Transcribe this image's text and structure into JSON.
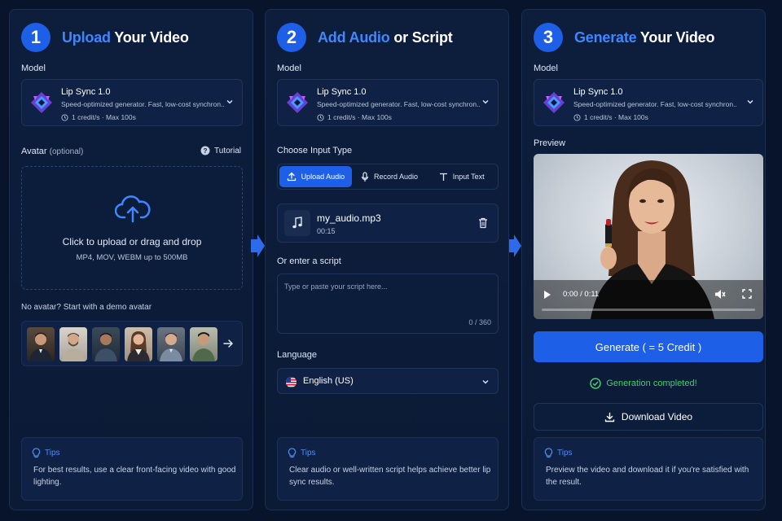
{
  "step1": {
    "number": "1",
    "title_accent": "Upload",
    "title_rest": " Your Video",
    "model_label": "Model",
    "model": {
      "name": "Lip Sync 1.0",
      "desc": "Speed-optimized generator. Fast, low-cost synchron...",
      "meta": "1 credit/s · Max 100s"
    },
    "avatar_label": "Avatar",
    "avatar_optional": "(optional)",
    "tutorial": "Tutorial",
    "upload_text": "Click to upload or drag and drop",
    "upload_sub": "MP4, MOV, WEBM up to 500MB",
    "demo_label": "No avatar? Start with a demo avatar",
    "tips_title": "Tips",
    "tips_body": "For best results, use a clear front-facing video with good lighting."
  },
  "step2": {
    "number": "2",
    "title_accent": "Add Audio",
    "title_rest": " or Script",
    "model_label": "Model",
    "model": {
      "name": "Lip Sync 1.0",
      "desc": "Speed-optimized generator. Fast, low-cost synchron...",
      "meta": "1 credit/s · Max 100s"
    },
    "input_type_label": "Choose Input Type",
    "tabs": [
      "Upload Audio",
      "Record Audio",
      "Input Text"
    ],
    "audio_file": {
      "name": "my_audio.mp3",
      "duration": "00:15"
    },
    "script_label": "Or enter a script",
    "script_placeholder": "Type or paste your script here...",
    "script_count": "0 / 360",
    "language_label": "Language",
    "language": "English (US)",
    "tips_title": "Tips",
    "tips_body": "Clear audio or well-written script helps achieve better lip sync results."
  },
  "step3": {
    "number": "3",
    "title_accent": "Generate",
    "title_rest": " Your Video",
    "model_label": "Model",
    "model": {
      "name": "Lip Sync 1.0",
      "desc": "Speed-optimized generator. Fast, low-cost synchron...",
      "meta": "1 credit/s · Max 100s"
    },
    "preview_label": "Preview",
    "time": "0:00 / 0:11",
    "generate_btn": "Generate ( = 5 Credit )",
    "status": "Generation completed!",
    "download_btn": "Download Video",
    "tips_title": "Tips",
    "tips_body": "Preview the video and download it if you're satisfied with the result."
  },
  "colors": {
    "accent": "#1d5fe6",
    "success": "#3ecf6e",
    "background": "#07142c"
  }
}
